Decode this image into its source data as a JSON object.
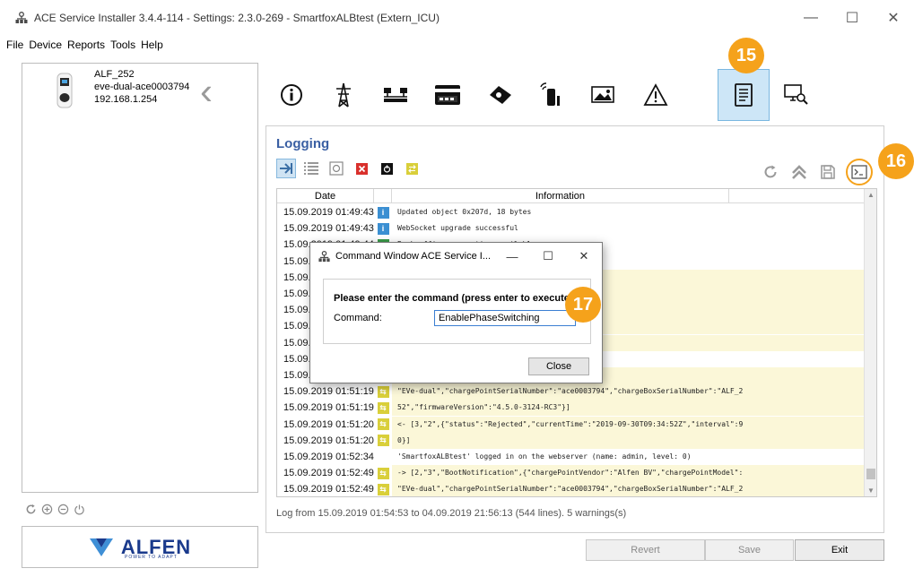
{
  "window": {
    "title": "ACE Service Installer 3.4.4-114 - Settings: 2.3.0-269 - SmartfoxALBtest (Extern_ICU)",
    "minimize": "—",
    "maximize": "☐",
    "close": "✕"
  },
  "menu": {
    "items": [
      "File",
      "Device",
      "Reports",
      "Tools",
      "Help"
    ]
  },
  "device": {
    "name": "ALF_252",
    "id": "eve-dual-ace0003794",
    "ip": "192.168.1.254",
    "collapse": "‹"
  },
  "left_tools": [
    "refresh-icon",
    "add-icon",
    "remove-icon",
    "power-icon"
  ],
  "logo": {
    "name": "ALFEN",
    "tagline": "POWER TO ADAPT",
    "brand_color": "#1a3a8c"
  },
  "toolbar": {
    "items": [
      "info-icon",
      "power-tower-icon",
      "network-icon",
      "card-icon",
      "payment-icon",
      "charger-signal-icon",
      "image-icon",
      "warning-icon",
      "logging-icon",
      "monitor-search-icon"
    ],
    "active": "logging-icon",
    "badge_logging": "15"
  },
  "logging": {
    "title": "Logging",
    "badge_command": "16",
    "headers": {
      "date": "Date",
      "info": "Information"
    },
    "rows": [
      {
        "date": "15.09.2019 01:49:43",
        "icon": "info",
        "info": "Updated object 0x207d,  18 bytes",
        "hl": false
      },
      {
        "date": "15.09.2019 01:49:43",
        "icon": "info",
        "info": "WebSocket upgrade successful",
        "hl": false
      },
      {
        "date": "15.09.2019 01:49:44",
        "icon": "green",
        "info": "Back office connection available",
        "hl": false
      },
      {
        "date": "15.09.2",
        "icon": "",
        "info": "",
        "hl": false
      },
      {
        "date": "15.09.2",
        "icon": "",
        "info": "dor\":\"Alfen BV\",\"chargePointModel\":",
        "hl": true
      },
      {
        "date": "15.09.2",
        "icon": "",
        "info": "94\",\"chargeBoxSerialNumber\":\"ALF_2",
        "hl": true
      },
      {
        "date": "15.09.2",
        "icon": "",
        "info": "",
        "hl": true
      },
      {
        "date": "15.09.2",
        "icon": "",
        "info": "2019-09-30T09:33:21Z\",\"interval\":9",
        "hl": true
      },
      {
        "date": "15.09.2",
        "icon": "",
        "info": "",
        "hl": true
      },
      {
        "date": "15.09.2",
        "icon": "",
        "info": "",
        "hl": false
      },
      {
        "date": "15.09.2",
        "icon": "",
        "info": "dor\":\"Alfen BV\",\"chargePointModel\":",
        "hl": true
      },
      {
        "date": "15.09.2019 01:51:19",
        "icon": "arrow",
        "info": "\"EVe-dual\",\"chargePointSerialNumber\":\"ace0003794\",\"chargeBoxSerialNumber\":\"ALF_2",
        "hl": true
      },
      {
        "date": "15.09.2019 01:51:19",
        "icon": "arrow",
        "info": "52\",\"firmwareVersion\":\"4.5.0-3124-RC3\"}]",
        "hl": true
      },
      {
        "date": "15.09.2019 01:51:20",
        "icon": "arrow",
        "info": "<- [3,\"2\",{\"status\":\"Rejected\",\"currentTime\":\"2019-09-30T09:34:52Z\",\"interval\":9",
        "hl": true
      },
      {
        "date": "15.09.2019 01:51:20",
        "icon": "arrow",
        "info": "0}]",
        "hl": true
      },
      {
        "date": "15.09.2019 01:52:34",
        "icon": "",
        "info": "'SmartfoxALBtest' logged in on the webserver (name: admin, level: 0)",
        "hl": false
      },
      {
        "date": "15.09.2019 01:52:49",
        "icon": "arrow",
        "info": "-> [2,\"3\",\"BootNotification\",{\"chargePointVendor\":\"Alfen BV\",\"chargePointModel\":",
        "hl": true
      },
      {
        "date": "15.09.2019 01:52:49",
        "icon": "arrow",
        "info": "\"EVe-dual\",\"chargePointSerialNumber\":\"ace0003794\",\"chargeBoxSerialNumber\":\"ALF_2",
        "hl": true
      }
    ],
    "status": "Log from 15.09.2019 01:54:53 to 04.09.2019 21:56:13 (544 lines). 5 warnings(s)"
  },
  "buttons": {
    "revert": "Revert",
    "save": "Save",
    "exit": "Exit"
  },
  "dialog": {
    "title": "Command Window ACE Service I...",
    "minimize": "—",
    "maximize": "☐",
    "close_x": "✕",
    "prompt": "Please enter the command (press enter to execute).",
    "label": "Command:",
    "value": "EnablePhaseSwitching",
    "close_button": "Close",
    "badge": "17"
  },
  "colors": {
    "accent": "#3a5fa3",
    "badge": "#f5a21b",
    "active_tab": "#cde6f7"
  }
}
